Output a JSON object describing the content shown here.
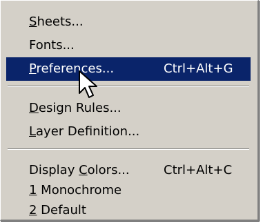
{
  "menu": {
    "items": [
      {
        "pre": "",
        "accel": "S",
        "post": "heets...",
        "shortcut": ""
      },
      {
        "pre": "Fonts...",
        "accel": "",
        "post": "",
        "shortcut": ""
      },
      {
        "pre": "",
        "accel": "P",
        "post": "references...",
        "shortcut": "Ctrl+Alt+G"
      },
      {
        "pre": "",
        "accel": "D",
        "post": "esign Rules...",
        "shortcut": ""
      },
      {
        "pre": "",
        "accel": "L",
        "post": "ayer Definition...",
        "shortcut": ""
      },
      {
        "pre": "Display ",
        "accel": "C",
        "post": "olors...",
        "shortcut": "Ctrl+Alt+C"
      },
      {
        "pre": "",
        "accel": "1",
        "post": " Monochrome",
        "shortcut": ""
      },
      {
        "pre": "",
        "accel": "2",
        "post": " Default",
        "shortcut": ""
      }
    ],
    "selected_index": 2,
    "colors": {
      "menu_bg": "#d4d0c8",
      "highlight_bg": "#0a246a",
      "highlight_text": "#ffffff",
      "text": "#000000"
    }
  },
  "cursor": {
    "icon": "arrow-pointer-icon"
  }
}
